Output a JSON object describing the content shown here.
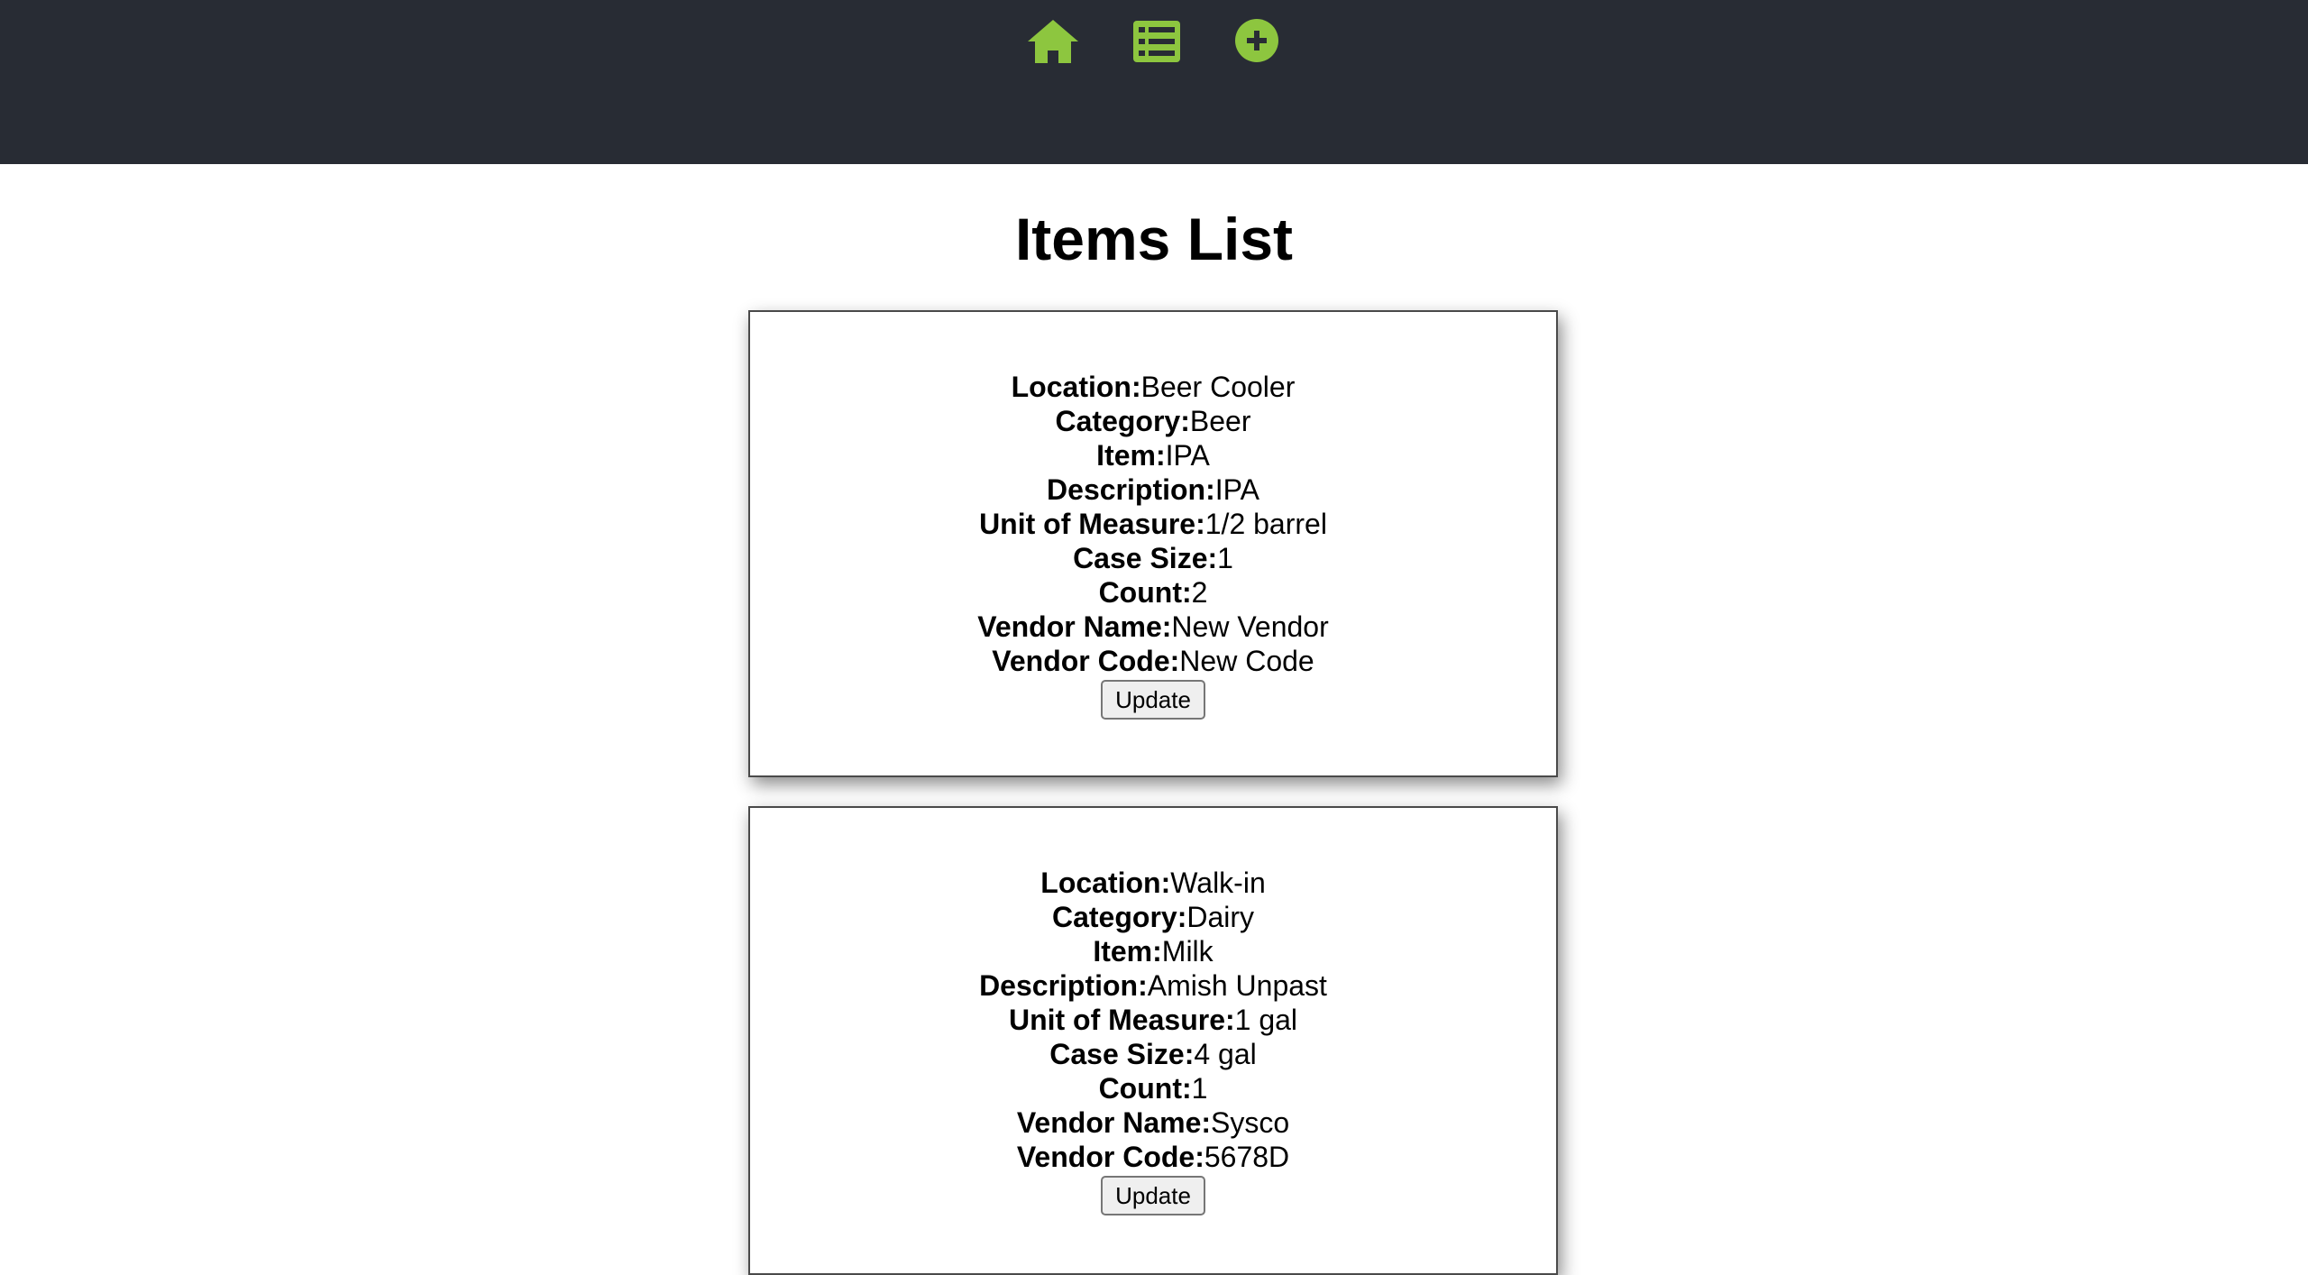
{
  "nav": {
    "icons": [
      {
        "name": "home-icon",
        "color": "#8dc63f"
      },
      {
        "name": "list-icon",
        "color": "#8dc63f"
      },
      {
        "name": "add-circle-icon",
        "color": "#8dc63f"
      }
    ],
    "background": "#282c34"
  },
  "page": {
    "title": "Items List"
  },
  "items": [
    {
      "location_label": "Location:",
      "location": "Beer Cooler",
      "category_label": "Category:",
      "category": "Beer",
      "item_label": "Item:",
      "item": "IPA",
      "description_label": "Description:",
      "description": "IPA",
      "uom_label": "Unit of Measure:",
      "uom": "1/2 barrel",
      "case_size_label": "Case Size:",
      "case_size": "1",
      "count_label": "Count:",
      "count": "2",
      "vendor_name_label": "Vendor Name:",
      "vendor_name": "New Vendor",
      "vendor_code_label": "Vendor Code:",
      "vendor_code": "New Code",
      "button_label": "Update"
    },
    {
      "location_label": "Location:",
      "location": "Walk-in",
      "category_label": "Category:",
      "category": "Dairy",
      "item_label": "Item:",
      "item": "Milk",
      "description_label": "Description:",
      "description": "Amish Unpast",
      "uom_label": "Unit of Measure:",
      "uom": "1 gal",
      "case_size_label": "Case Size:",
      "case_size": "4 gal",
      "count_label": "Count:",
      "count": "1",
      "vendor_name_label": "Vendor Name:",
      "vendor_name": "Sysco",
      "vendor_code_label": "Vendor Code:",
      "vendor_code": "5678D",
      "button_label": "Update"
    }
  ]
}
